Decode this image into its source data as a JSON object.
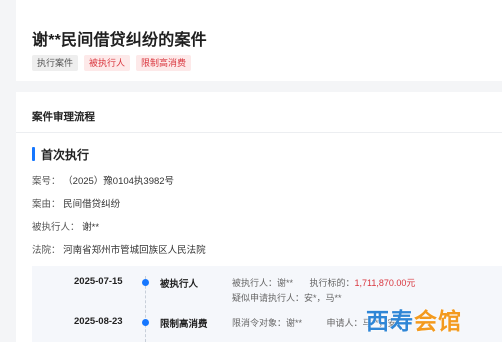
{
  "header": {
    "title": "谢**民间借贷纠纷的案件",
    "tags": [
      {
        "label": "执行案件",
        "style": "gray"
      },
      {
        "label": "被执行人",
        "style": "red"
      },
      {
        "label": "限制高消费",
        "style": "red"
      }
    ]
  },
  "main": {
    "section_title": "案件审理流程",
    "sub_title": "首次执行",
    "info": {
      "case_no_label": "案号：",
      "case_no": "（2025）豫0104执3982号",
      "cause_label": "案由：",
      "cause": "民间借贷纠纷",
      "respondent_label": "被执行人：",
      "respondent": "谢**",
      "court_label": "法院：",
      "court": "河南省郑州市管城回族区人民法院"
    },
    "timeline": [
      {
        "date": "2025-07-15",
        "type": "被执行人",
        "detail_line1_a": "被执行人：谢**",
        "detail_line1_b_label": "执行标的：",
        "detail_line1_b_value": "1,711,870.00元",
        "detail_line2": "疑似申请执行人：安*，马**"
      },
      {
        "date": "2025-08-23",
        "type": "限制高消费",
        "detail_line1_a": "限消令对象：谢**",
        "detail_line1_b_label": "申请人：",
        "detail_line1_b_value": "马**，安*"
      }
    ]
  },
  "watermark": {
    "part1": "西寿",
    "part2": "会馆"
  },
  "colors": {
    "accent": "#1677ff",
    "danger": "#d9363e",
    "tag_red_bg": "#fde9e9"
  }
}
